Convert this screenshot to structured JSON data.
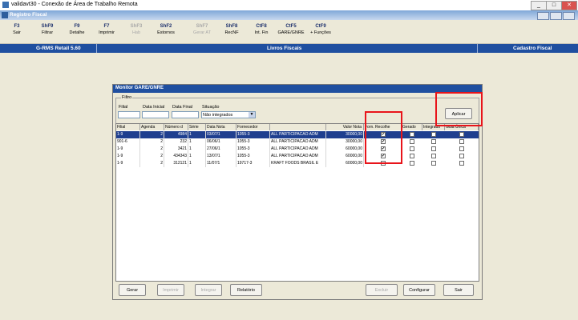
{
  "remote_window": {
    "title": "validavt30 - Conexão de Área de Trabalho Remota",
    "minimize": "_",
    "maximize": "□",
    "close": "✕"
  },
  "app": {
    "title": "Registro Fiscal",
    "controls": [
      "_",
      "□",
      "✕"
    ]
  },
  "toolbar": {
    "items": [
      {
        "key": "F3",
        "label": "Sair",
        "enabled": true
      },
      {
        "key": "ShF9",
        "label": "Filtrar",
        "enabled": true
      },
      {
        "key": "F9",
        "label": "Detalhe",
        "enabled": true
      },
      {
        "key": "F7",
        "label": "Imprimir",
        "enabled": true
      },
      {
        "key": "ShF3",
        "label": "Hab",
        "enabled": false
      },
      {
        "key": "ShF2",
        "label": "Estornos",
        "enabled": true
      },
      {
        "key": "ShF7",
        "label": "Gerar AT",
        "enabled": false
      },
      {
        "key": "ShF8",
        "label": "RecNF",
        "enabled": true
      },
      {
        "key": "CtF8",
        "label": "Int. Fin",
        "enabled": true
      },
      {
        "key": "CtF5",
        "label": "GARE/GNRE",
        "enabled": true
      },
      {
        "key": "CtF9",
        "label": "+ Funções",
        "enabled": true
      }
    ]
  },
  "banner": {
    "left": "G-RMS Retail 5.60",
    "center": "Livros Fiscais",
    "right": "Cadastro Fiscal"
  },
  "dialog": {
    "title": "Monitor GARE/GNRE",
    "filter": {
      "legend": "Filtro",
      "filial_label": "Filial",
      "data_inicial_label": "Data Inicial",
      "data_final_label": "Data Final",
      "situacao_label": "Situação",
      "situacao_value": "Não integrados",
      "aplicar_label": "Aplicar"
    },
    "columns": [
      "Filial",
      "Agenda",
      "Número d",
      "Série",
      "Data Nota",
      "Fornecedor",
      "",
      "Valor Nota",
      "Forn. Recolhe",
      "Gerado",
      "Integrado",
      "Guia Única"
    ],
    "rows": [
      {
        "filial": "1-9",
        "agenda": "2",
        "numero": "4984",
        "serie": "1",
        "data": "03/07/1",
        "forn_cod": "1055-3",
        "forn_nome": "ALL PARTICIPACAO ADM",
        "valor": "30000,00",
        "forn_recolhe": true,
        "gerado": false,
        "integrado": false,
        "guia": false,
        "selected": true
      },
      {
        "filial": "901-6",
        "agenda": "2",
        "numero": "232",
        "serie": "1",
        "data": "06/06/1",
        "forn_cod": "1055-3",
        "forn_nome": "ALL PARTICIPACAO ADM",
        "valor": "30000,00",
        "forn_recolhe": true,
        "gerado": false,
        "integrado": false,
        "guia": false,
        "selected": false
      },
      {
        "filial": "1-9",
        "agenda": "2",
        "numero": "3421",
        "serie": "1",
        "data": "27/06/1",
        "forn_cod": "1055-3",
        "forn_nome": "ALL PARTICIPACAO ADM",
        "valor": "60000,00",
        "forn_recolhe": true,
        "gerado": false,
        "integrado": false,
        "guia": false,
        "selected": false
      },
      {
        "filial": "1-9",
        "agenda": "2",
        "numero": "434343",
        "serie": "1",
        "data": "13/07/1",
        "forn_cod": "1055-3",
        "forn_nome": "ALL PARTICIPACAO ADM",
        "valor": "60000,00",
        "forn_recolhe": true,
        "gerado": false,
        "integrado": false,
        "guia": false,
        "selected": false
      },
      {
        "filial": "1-9",
        "agenda": "2",
        "numero": "312121",
        "serie": "1",
        "data": "11/07/1",
        "forn_cod": "19717-3",
        "forn_nome": "KRAFT FOODS BRASIL E",
        "valor": "60000,00",
        "forn_recolhe": false,
        "gerado": false,
        "integrado": false,
        "guia": false,
        "selected": false
      }
    ],
    "buttons": {
      "gerar": "Gerar",
      "imprimir": "Imprimir",
      "integrar": "Integrar",
      "relatorio": "Relatório",
      "excluir": "Excluir",
      "configurar": "Configurar",
      "sair": "Sair"
    }
  }
}
